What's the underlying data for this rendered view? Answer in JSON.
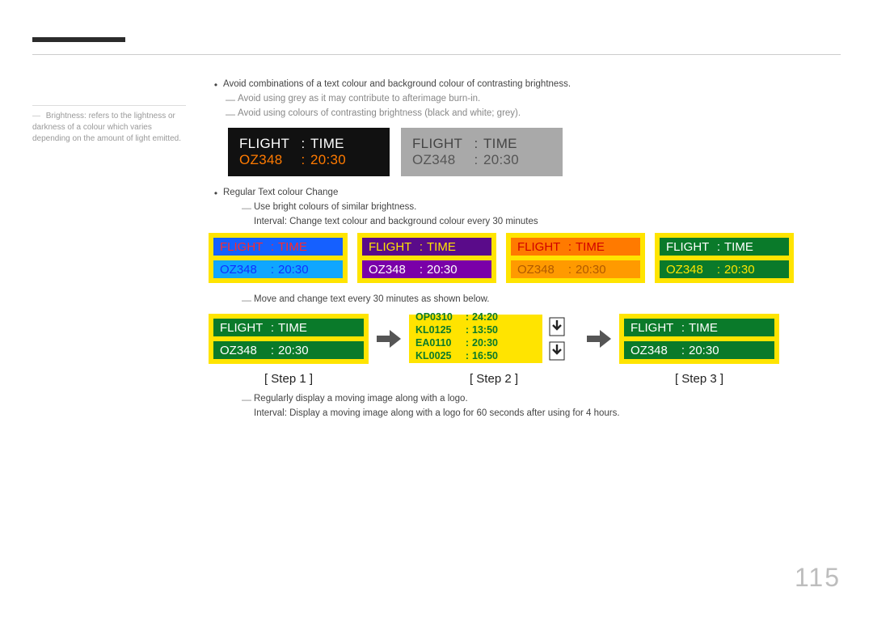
{
  "page_number": "115",
  "sidenote": {
    "prefix": "―",
    "text": "Brightness: refers to the lightness or darkness of a colour which varies depending on the amount of light emitted."
  },
  "bullets": {
    "b1": "Avoid combinations of a text colour and background colour of contrasting brightness.",
    "b1a": "Avoid using grey as it may contribute to afterimage burn-in.",
    "b1b": "Avoid using colours of contrasting brightness (black and white; grey).",
    "b2": "Regular Text colour Change",
    "b2a": "Use bright colours of similar brightness.",
    "b2a_interval": "Interval: Change text colour and background colour every 30 minutes",
    "b2b": "Move and change text every 30 minutes as shown below.",
    "b2c": "Regularly display a moving image along with a logo.",
    "b2c_interval": "Interval: Display a moving image along with a logo for 60 seconds after using for 4 hours."
  },
  "flight_header": {
    "col1": "FLIGHT",
    "sep": ":",
    "col2": "TIME"
  },
  "flight_row": {
    "col1": "OZ348",
    "sep": ":",
    "col2": "20:30"
  },
  "step2_rows": [
    {
      "c1": "OP0310",
      "sep": ":",
      "c2": "24:20"
    },
    {
      "c1": "KL0125",
      "sep": ":",
      "c2": "13:50"
    },
    {
      "c1": "EA0110",
      "sep": ":",
      "c2": "20:30"
    },
    {
      "c1": "KL0025",
      "sep": ":",
      "c2": "16:50"
    }
  ],
  "steps": {
    "s1": "[ Step 1 ]",
    "s2": "[ Step 2 ]",
    "s3": "[ Step 3 ]"
  },
  "bullet_marker": "•",
  "dash_marker": "―"
}
